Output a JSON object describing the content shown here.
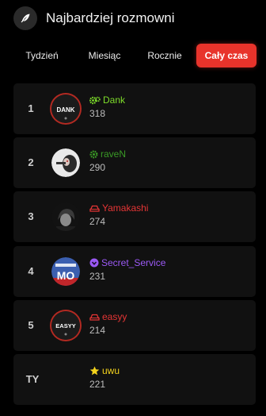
{
  "header": {
    "title": "Najbardziej rozmowni",
    "icon": "feather-pen-icon"
  },
  "tabs": [
    {
      "label": "Tydzień",
      "active": false
    },
    {
      "label": "Miesiąc",
      "active": false
    },
    {
      "label": "Rocznie",
      "active": false
    },
    {
      "label": "Cały czas",
      "active": true
    }
  ],
  "leaderboard": [
    {
      "rank": "1",
      "name": "Dank",
      "score": "318",
      "name_color": "#7ddc2a",
      "badge": "gears-icon",
      "avatar_text": "DANK"
    },
    {
      "rank": "2",
      "name": "raveN",
      "score": "290",
      "name_color": "#3a9a26",
      "badge": "gear-icon",
      "avatar_text": ""
    },
    {
      "rank": "3",
      "name": "Yamakashi",
      "score": "274",
      "name_color": "#e53535",
      "badge": "car-icon",
      "avatar_text": ""
    },
    {
      "rank": "4",
      "name": "Secret_Service",
      "score": "231",
      "name_color": "#9b59f5",
      "badge": "check-badge-icon",
      "avatar_text": "MO"
    },
    {
      "rank": "5",
      "name": "easyy",
      "score": "214",
      "name_color": "#e53535",
      "badge": "car-icon",
      "avatar_text": "EASYY"
    }
  ],
  "you": {
    "rank": "TY",
    "name": "uwu",
    "score": "221",
    "name_color": "#f4d31c",
    "badge": "star-icon"
  },
  "colors": {
    "accent": "#e8332b",
    "row_bg": "#111111",
    "page_bg": "#000000"
  }
}
